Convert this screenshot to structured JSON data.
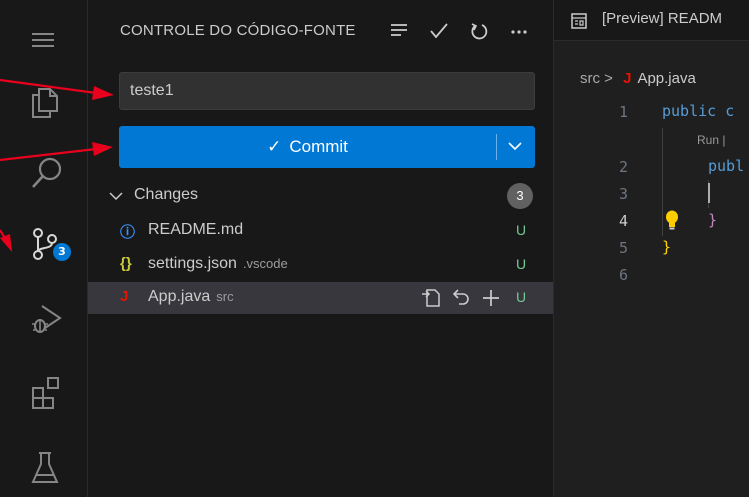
{
  "activity_bar": {
    "items": [
      {
        "name": "menu",
        "icon": "hamburger-menu-icon"
      },
      {
        "name": "explorer",
        "icon": "files-icon"
      },
      {
        "name": "search",
        "icon": "search-icon"
      },
      {
        "name": "source-control",
        "icon": "source-control-icon",
        "badge": "3"
      },
      {
        "name": "run-debug",
        "icon": "run-debug-icon"
      },
      {
        "name": "extensions",
        "icon": "extensions-icon"
      },
      {
        "name": "testing",
        "icon": "flask-icon"
      }
    ]
  },
  "sidebar": {
    "title": "CONTROLE DO CÓDIGO-FONTE",
    "actions": [
      "view-as-list-icon",
      "check-icon",
      "refresh-icon",
      "more-icon"
    ],
    "commit_message": "teste1",
    "commit_button": {
      "check": "✓",
      "label": "Commit"
    },
    "changes": {
      "label": "Changes",
      "count": "3",
      "files": [
        {
          "icon": "ⓘ",
          "icon_color": "#3794ff",
          "name": "README.md",
          "dir": "",
          "status": "U"
        },
        {
          "icon": "{}",
          "icon_color": "#cbcb41",
          "name": "settings.json",
          "dir": ".vscode",
          "status": "U"
        },
        {
          "icon": "J",
          "icon_color": "#e51400",
          "name": "App.java",
          "dir": "src",
          "status": "U"
        }
      ]
    }
  },
  "editor": {
    "tab": {
      "label": "[Preview] READM"
    },
    "breadcrumb": {
      "folder": "src",
      "sep": ">",
      "file_icon": "J",
      "file": "App.java"
    },
    "lines": [
      {
        "no": "1",
        "text": "public c"
      },
      {
        "no": "2",
        "text": "publ"
      },
      {
        "no": "3",
        "text": ""
      },
      {
        "no": "4",
        "text": "}"
      },
      {
        "no": "5",
        "text": "}"
      },
      {
        "no": "6",
        "text": ""
      }
    ],
    "codelens": "Run |"
  },
  "colors": {
    "accent": "#0078d4",
    "annotation_arrow": "#e8001c",
    "untracked": "#73c991"
  }
}
